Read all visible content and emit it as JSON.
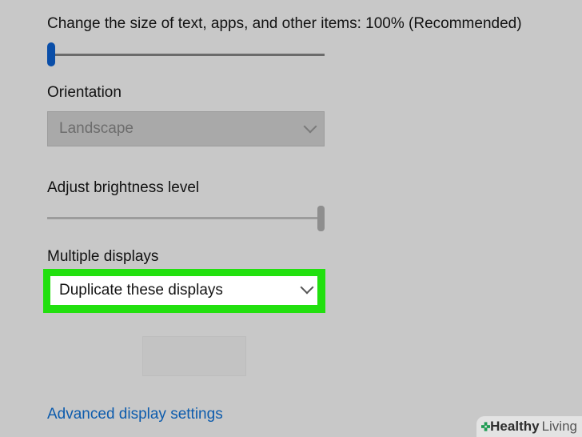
{
  "scale": {
    "label": "Change the size of text, apps, and other items: 100% (Recommended)",
    "level_fraction": 0.0
  },
  "orientation": {
    "label": "Orientation",
    "selected": "Landscape",
    "disabled": true
  },
  "brightness": {
    "label": "Adjust brightness level",
    "level_fraction": 1.0
  },
  "multiple_displays": {
    "label": "Multiple displays",
    "selected": "Duplicate these displays",
    "highlight_color": "#22e00f"
  },
  "links": {
    "advanced": "Advanced display settings"
  },
  "watermark": {
    "brand": "Healthy",
    "second": "Living",
    "icon": "plus-cross-icon"
  },
  "colors": {
    "background": "#c8c8c8",
    "accent": "#0a4ea8",
    "link": "#0d5cad"
  }
}
